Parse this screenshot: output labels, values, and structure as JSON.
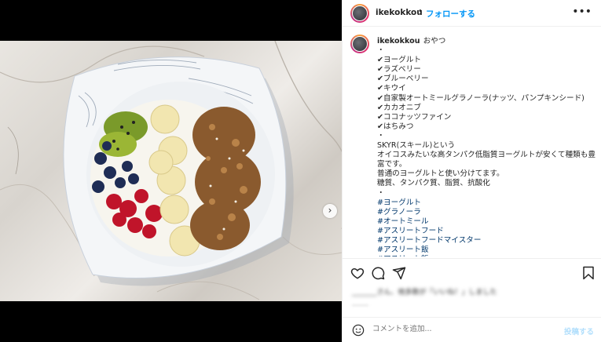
{
  "post": {
    "username": "ikekokkou",
    "separator": "•",
    "follow_label": "フォローする",
    "more_icon": "more-horizontal-icon"
  },
  "caption": {
    "username": "ikekokkou",
    "lines": [
      "おやつ",
      "・",
      "✔ヨーグルト",
      "✔ラズベリー",
      "✔ブルーベリー",
      "✔キウイ",
      "✔自家製オートミールグラノーラ(ナッツ、パンプキンシード)",
      "✔カカオニブ",
      "✔ココナッツファイン",
      "✔はちみつ",
      "・",
      "SKYR(スキール)という",
      "オイコスみたいな高タンパク低脂質ヨーグルトが安くて種類も豊富です。",
      "普通のヨーグルトと使い分けてます。",
      "糖質、タンパク質、脂質、抗酸化",
      "・"
    ],
    "hashtags": [
      "#ヨーグルト",
      "#グラノーラ",
      "#オートミール",
      "#アスリートフード",
      "#アスリートフードマイスター",
      "#アスリート飯",
      "#アスリート飯"
    ]
  },
  "actions": {
    "like_icon": "heart-icon",
    "comment_icon": "comment-icon",
    "share_icon": "share-icon",
    "save_icon": "bookmark-icon"
  },
  "likes_text": "_______さん、他多数が「いいね！」しました",
  "date_text": "______",
  "comment": {
    "placeholder": "コメントを追加...",
    "post_label": "投稿する",
    "emoji_icon": "emoji-icon"
  },
  "media": {
    "next_icon": "chevron-right-icon"
  }
}
